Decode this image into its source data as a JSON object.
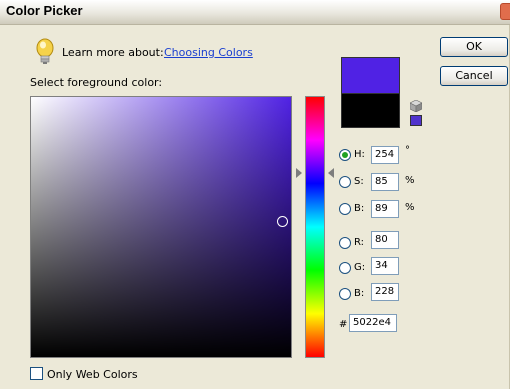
{
  "window": {
    "title": "Color Picker"
  },
  "learn_more": {
    "prefix": "Learn more about:",
    "link": "Choosing Colors"
  },
  "select_label": "Select foreground color:",
  "colors": {
    "new": "#5022e4",
    "old": "#000000",
    "hue_base": "#5022e4",
    "web_safe": "#5033cc"
  },
  "buttons": {
    "ok": "OK",
    "cancel": "Cancel"
  },
  "fields": {
    "h": {
      "label": "H:",
      "value": "254",
      "unit": "°"
    },
    "s": {
      "label": "S:",
      "value": "85",
      "unit": "%"
    },
    "b": {
      "label": "B:",
      "value": "89",
      "unit": "%"
    },
    "r": {
      "label": "R:",
      "value": "80"
    },
    "g": {
      "label": "G:",
      "value": "34"
    },
    "b2": {
      "label": "B:",
      "value": "228"
    },
    "hex": {
      "label": "#",
      "value": "5022e4"
    }
  },
  "selected_mode": "H",
  "only_web_colors": {
    "label": "Only Web Colors",
    "checked": false
  },
  "icons": [
    "lightbulb-icon",
    "close-icon",
    "cube-icon"
  ]
}
